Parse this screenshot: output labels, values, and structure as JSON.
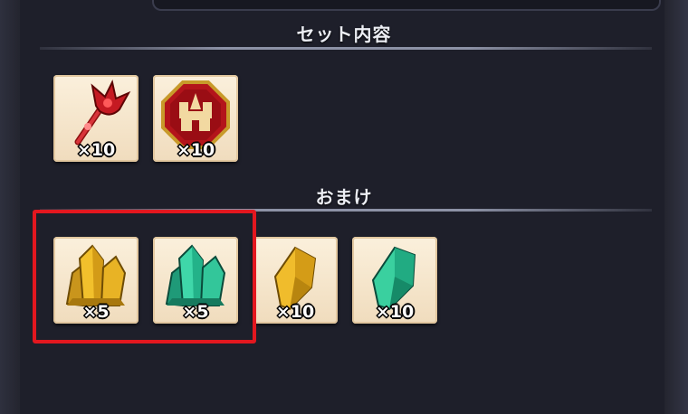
{
  "colors": {
    "background": "#1e1f2a",
    "tile": "#f5e6cc",
    "highlight": "#e3171f",
    "divider": "#8d92a6"
  },
  "sections": {
    "set_contents": {
      "title": "セット内容",
      "items": [
        {
          "icon": "red-scepter-icon",
          "qty": "×10"
        },
        {
          "icon": "red-castle-medal-icon",
          "qty": "×10"
        }
      ]
    },
    "bonus": {
      "title": "おまけ",
      "items": [
        {
          "icon": "gold-crystal-cluster-icon",
          "qty": "×5",
          "highlighted": true
        },
        {
          "icon": "green-crystal-cluster-icon",
          "qty": "×5",
          "highlighted": true
        },
        {
          "icon": "gold-crystal-icon",
          "qty": "×10"
        },
        {
          "icon": "green-crystal-icon",
          "qty": "×10"
        }
      ]
    }
  }
}
